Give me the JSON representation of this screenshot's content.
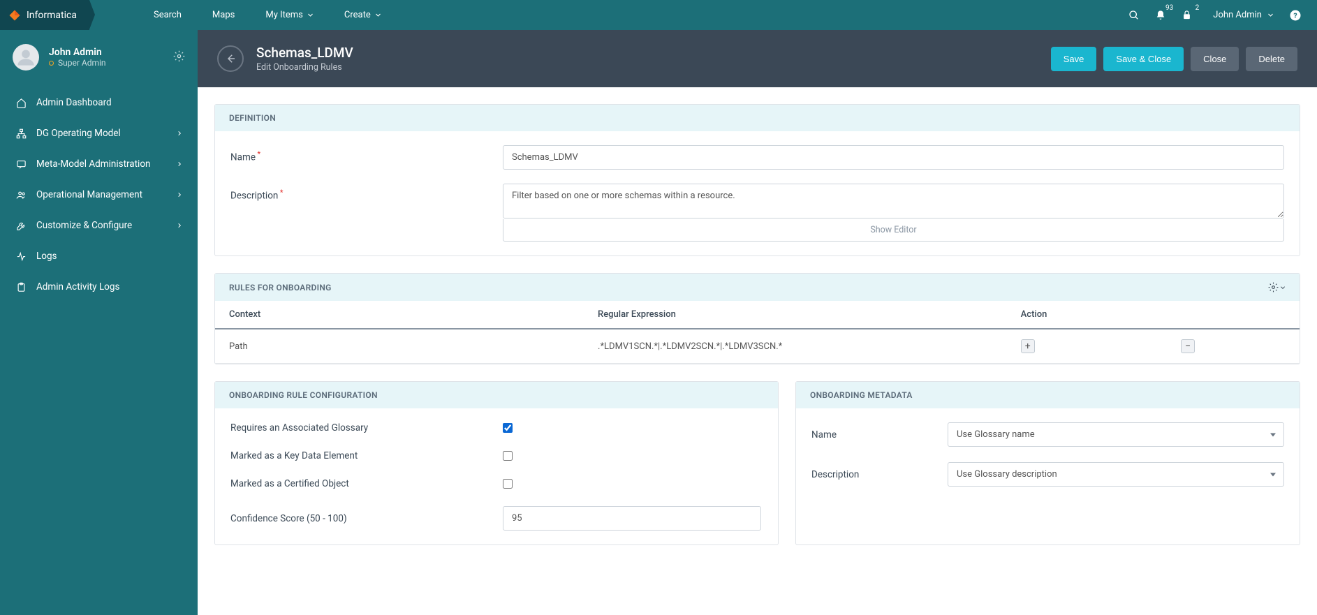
{
  "brand": {
    "name": "Informatica"
  },
  "top_nav": {
    "items": [
      "Search",
      "Maps",
      "My Items",
      "Create"
    ],
    "notification_badge": "93",
    "lock_badge": "2",
    "user_name": "John Admin"
  },
  "sidebar": {
    "user": {
      "name": "John Admin",
      "role": "Super Admin"
    },
    "items": [
      {
        "label": "Admin Dashboard",
        "icon": "home",
        "has_children": false
      },
      {
        "label": "DG Operating Model",
        "icon": "diagram",
        "has_children": true
      },
      {
        "label": "Meta-Model Administration",
        "icon": "chat",
        "has_children": true
      },
      {
        "label": "Operational Management",
        "icon": "users",
        "has_children": true
      },
      {
        "label": "Customize & Configure",
        "icon": "wrench",
        "has_children": true
      },
      {
        "label": "Logs",
        "icon": "pulse",
        "has_children": false
      },
      {
        "label": "Admin Activity Logs",
        "icon": "clipboard",
        "has_children": false
      }
    ]
  },
  "page": {
    "title": "Schemas_LDMV",
    "subtitle": "Edit Onboarding Rules",
    "actions": {
      "save": "Save",
      "save_close": "Save & Close",
      "close": "Close",
      "delete": "Delete"
    }
  },
  "definition": {
    "panel_title": "DEFINITION",
    "name_label": "Name",
    "name_value": "Schemas_LDMV",
    "description_label": "Description",
    "description_value": "Filter based on one or more schemas within a resource.",
    "show_editor_label": "Show Editor"
  },
  "rules": {
    "panel_title": "RULES FOR ONBOARDING",
    "columns": {
      "context": "Context",
      "regex": "Regular Expression",
      "action": "Action"
    },
    "rows": [
      {
        "context": "Path",
        "regex": ".*LDMV1SCN.*|.*LDMV2SCN.*|.*LDMV3SCN.*"
      }
    ]
  },
  "config": {
    "panel_title": "ONBOARDING RULE CONFIGURATION",
    "glossary_label": "Requires an Associated Glossary",
    "glossary_checked": true,
    "key_element_label": "Marked as a Key Data Element",
    "key_element_checked": false,
    "certified_label": "Marked as a Certified Object",
    "certified_checked": false,
    "confidence_label": "Confidence Score (50 - 100)",
    "confidence_value": "95"
  },
  "metadata": {
    "panel_title": "ONBOARDING METADATA",
    "name_label": "Name",
    "name_value": "Use Glossary name",
    "description_label": "Description",
    "description_value": "Use Glossary description"
  }
}
